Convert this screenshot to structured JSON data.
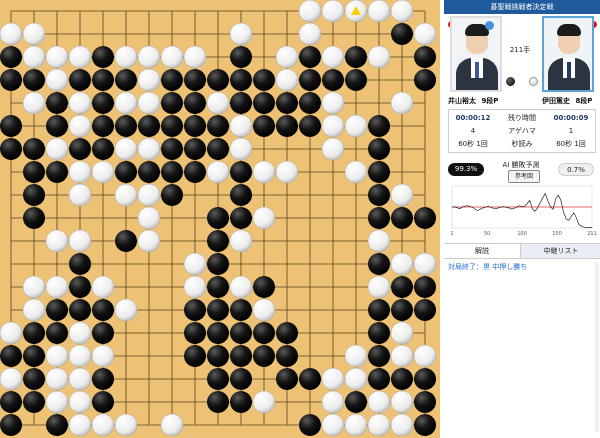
{
  "header_title": "碁聖戦挑戦者決定戦",
  "move_count": "211手",
  "black_player": {
    "name": "井山裕太",
    "rank": "9段P"
  },
  "white_player": {
    "name": "伊田篤史",
    "rank": "8段P"
  },
  "stats": {
    "time_label": "残り時間",
    "black_time": "00:00:12",
    "white_time": "00:00:09",
    "captures_label": "アゲハマ",
    "black_captures": "4",
    "white_captures": "1",
    "byoyomi_label": "秒読み",
    "black_byoyomi": "60秒 1回",
    "white_byoyomi": "60秒 1回"
  },
  "ai": {
    "black_pct": "99.3%",
    "label": "AI 勝敗予測",
    "button": "参考図",
    "white_pct": "0.7%"
  },
  "graph": {
    "x_ticks": [
      "1",
      "50",
      "100",
      "150",
      "211"
    ],
    "values": [
      50,
      50,
      48,
      46,
      50,
      52,
      53,
      51,
      49,
      44,
      42,
      45,
      48,
      50,
      52,
      49,
      47,
      46,
      48,
      50,
      51,
      49,
      48,
      45,
      47,
      50,
      53,
      51,
      52,
      58,
      66,
      45,
      40,
      48,
      60,
      72,
      82,
      65,
      50,
      45,
      70,
      78,
      66,
      38,
      22,
      18,
      28,
      36,
      24,
      8,
      4,
      2,
      1,
      1,
      1
    ]
  },
  "tabs": {
    "commentary": "解説",
    "relay": "中継リスト"
  },
  "commentary_text": "対局終了：黒 中押し勝ち",
  "colors": {
    "board": "#eec275",
    "header": "#1f5b9c",
    "accent": "#5aa2d8",
    "red_mark": "#e11"
  },
  "board": {
    "size": 19,
    "last_move": [
      15,
      0
    ],
    "rows": [
      "XXXXXXXXXXXXXOOOOOX",
      "OOXXXXXXXXOXXOXXXBO",
      "BOOOBOOOOXBXOBOBOXB",
      "BBOBBBOBBBBBOBBBXXB",
      "XOBOBOOBBOBBBBOXXOX",
      "BXBOBBBBBBOBBBOOBXX",
      "BBOBBOOBBBOXXXOXBXX",
      "XBBOOBBBBOBOOXXOBXX",
      "XBXOXOOBXXBXXXXXBOX",
      "XBXXXXOXXBBOXXXXBBB",
      "XXOOXBOXXBOXXXXXOXX",
      "XXXBXXXXOBXXXXXXBOO",
      "XOOBOXXXOBOBXXXXOBB",
      "XOBBBOXXBBBOXXXXBBB",
      "OBBOBXXXBBBBBXXXBOX",
      "BBOOOXXXBBBBBXXOBOO",
      "OBOOBXXXXBBXBBOOBBB",
      "BBOOBXXXXBBOXXOBOOB",
      "BXBOOOXOXXXXXBOOOOB"
    ]
  }
}
